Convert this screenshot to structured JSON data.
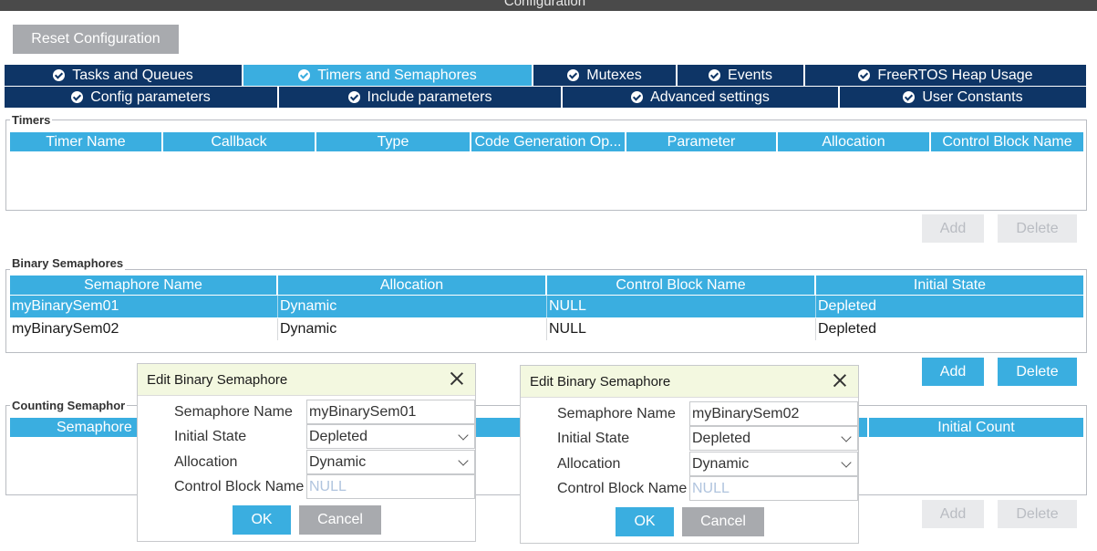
{
  "window": {
    "title": "Configuration"
  },
  "reset_button": "Reset Configuration",
  "tabs_row1": [
    {
      "label": "Tasks and Queues",
      "active": false
    },
    {
      "label": "Timers and Semaphores",
      "active": true
    },
    {
      "label": "Mutexes",
      "active": false
    },
    {
      "label": "Events",
      "active": false
    },
    {
      "label": "FreeRTOS Heap Usage",
      "active": false
    }
  ],
  "tabs_row2": [
    {
      "label": "Config parameters"
    },
    {
      "label": "Include parameters"
    },
    {
      "label": "Advanced settings"
    },
    {
      "label": "User Constants"
    }
  ],
  "timers": {
    "label": "Timers",
    "columns": [
      "Timer Name",
      "Callback",
      "Type",
      "Code Generation Op...",
      "Parameter",
      "Allocation",
      "Control Block Name"
    ],
    "add": "Add",
    "delete": "Delete"
  },
  "binary": {
    "label": "Binary Semaphores",
    "columns": [
      "Semaphore Name",
      "Allocation",
      "Control Block Name",
      "Initial State"
    ],
    "rows": [
      [
        "myBinarySem01",
        "Dynamic",
        "NULL",
        "Depleted"
      ],
      [
        "myBinarySem02",
        "Dynamic",
        "NULL",
        "Depleted"
      ]
    ],
    "add": "Add",
    "delete": "Delete"
  },
  "counting": {
    "label": "Counting Semaphor",
    "columns": [
      "Semaphore",
      "Initial Count"
    ],
    "add": "Add",
    "delete": "Delete"
  },
  "dialogs": [
    {
      "title": "Edit Binary Semaphore",
      "name_label": "Semaphore Name",
      "name_value": "myBinarySem01",
      "state_label": "Initial State",
      "state_value": "Depleted",
      "alloc_label": "Allocation",
      "alloc_value": "Dynamic",
      "cb_label": "Control Block Name",
      "cb_value": "NULL",
      "ok": "OK",
      "cancel": "Cancel"
    },
    {
      "title": "Edit Binary Semaphore",
      "name_label": "Semaphore Name",
      "name_value": "myBinarySem02",
      "state_label": "Initial State",
      "state_value": "Depleted",
      "alloc_label": "Allocation",
      "alloc_value": "Dynamic",
      "cb_label": "Control Block Name",
      "cb_value": "NULL",
      "ok": "OK",
      "cancel": "Cancel"
    }
  ],
  "colors": {
    "accent": "#3aaee0",
    "tab_dark": "#0e3566",
    "dialog_title_bg": "#f3f8e0"
  }
}
